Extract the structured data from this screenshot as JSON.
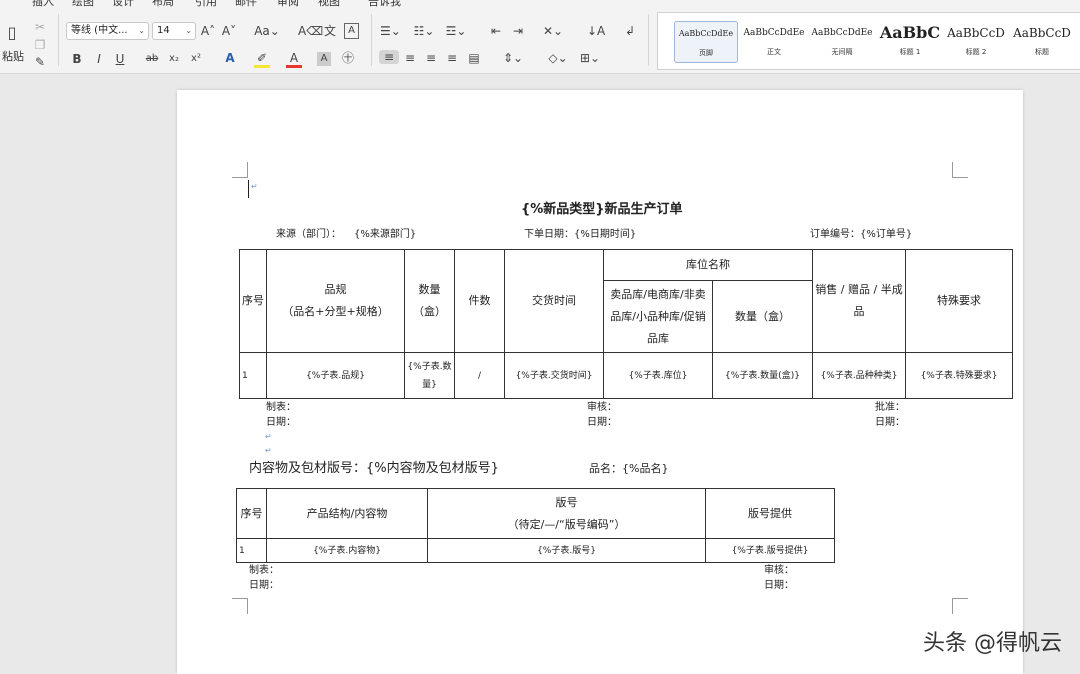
{
  "menu": [
    "插入",
    "绘图",
    "设计",
    "布局",
    "引用",
    "邮件",
    "审阅",
    "视图",
    "告诉我"
  ],
  "ribbon": {
    "paste_label": "粘贴",
    "font_name": "等线 (中文...",
    "font_size": "14",
    "bold": "B",
    "italic": "I",
    "underline": "U",
    "strike": "ab",
    "sub": "x₂",
    "sup": "x²",
    "aa": "Aa",
    "styles": [
      {
        "preview": "AaBbCcDdEe",
        "name": "页脚"
      },
      {
        "preview": "AaBbCcDdEe",
        "name": "正文"
      },
      {
        "preview": "AaBbCcDdEe",
        "name": "无间隔"
      },
      {
        "preview": "AaBbC",
        "name": "标题 1"
      },
      {
        "preview": "AaBbCcD",
        "name": "标题 2"
      },
      {
        "preview": "AaBbCcD",
        "name": "标题"
      }
    ]
  },
  "doc": {
    "title": "{%新品类型}新品生产订单",
    "source_label": "来源（部门）：",
    "source_value": "{%来源部门}",
    "order_date_label": "下单日期：{%日期时间}",
    "order_no_label": "订单编号：{%订单号}",
    "table1": {
      "h_seq": "序号",
      "h_spec1": "品规",
      "h_spec2": "（品名+分型+规格）",
      "h_qty1": "数量",
      "h_qty2": "（盒）",
      "h_pieces": "件数",
      "h_delivery": "交货时间",
      "h_location": "库位名称",
      "h_loc_sub": "卖品库/电商库/非卖品库/小品种库/促销品库",
      "h_loc_qty": "数量（盒）",
      "h_sale": "销售 / 赠品 / 半成品",
      "h_special": "特殊要求",
      "row": {
        "seq": "1",
        "spec": "{%子表.品规}",
        "qty": "{%子表.数量}",
        "pieces": "/",
        "delivery": "{%子表.交货时间}",
        "location": "{%子表.库位}",
        "loc_qty": "{%子表.数量(盒)}",
        "sale": "{%子表.品种种类}",
        "special": "{%子表.特殊要求}"
      }
    },
    "sign1": {
      "maker": "制表：",
      "date": "日期：",
      "review": "审核：",
      "review_date": "日期：",
      "approve": "批准：",
      "approve_date": "日期："
    },
    "section2_title": "内容物及包材版号：{%内容物及包材版号}",
    "product_name": "品名：{%品名}",
    "table2": {
      "h_seq": "序号",
      "h_struct": "产品结构/内容物",
      "h_ver1": "版号",
      "h_ver2": "（待定/—/“版号编码”）",
      "h_provider": "版号提供",
      "row": {
        "seq": "1",
        "struct": "{%子表.内容物}",
        "ver": "{%子表.版号}",
        "provider": "{%子表.版号提供}"
      }
    },
    "sign2": {
      "maker": "制表：",
      "date": "日期：",
      "review": "审核：",
      "review_date": "日期："
    }
  },
  "watermark": "头条 @得帆云"
}
